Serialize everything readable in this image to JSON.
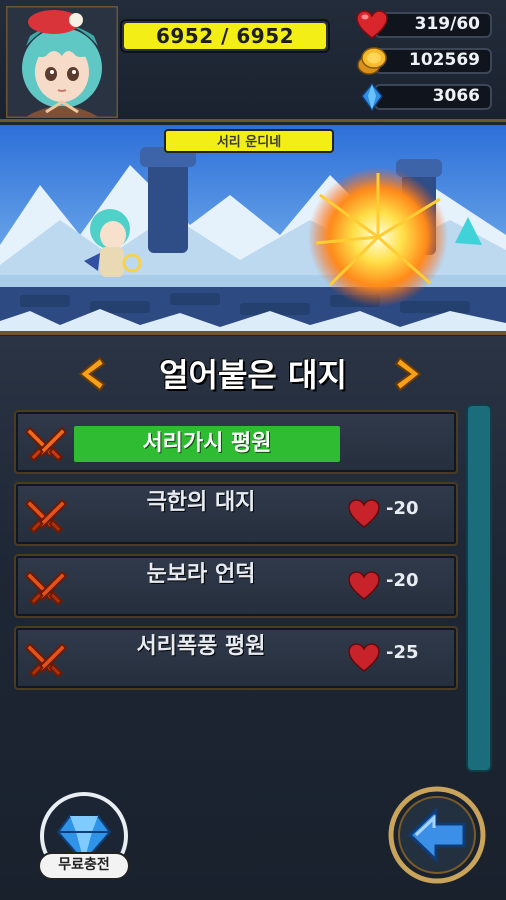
{
  "header": {
    "hp_text": "6952 / 6952",
    "stamina_text": "319/60",
    "gold_text": "102569",
    "gem_text": "3066"
  },
  "scene": {
    "stage_label": "서리 운디네"
  },
  "panel": {
    "title": "얼어붙은 대지",
    "prev_arrow": "chevron-left-icon",
    "next_arrow": "chevron-right-icon"
  },
  "stages": [
    {
      "name": "서리가시 평원",
      "cost": "",
      "selected": true
    },
    {
      "name": "극한의 대지",
      "cost": "-20",
      "selected": false
    },
    {
      "name": "눈보라 언덕",
      "cost": "-20",
      "selected": false
    },
    {
      "name": "서리폭풍 평원",
      "cost": "-25",
      "selected": false
    }
  ],
  "footer": {
    "free_charge_label": "무료충전"
  },
  "colors": {
    "hp_bar": "#f2ee16",
    "selected_row": "#2fbc33",
    "gold_frame": "#6b5532",
    "scrollbar": "#1c6d7c"
  }
}
